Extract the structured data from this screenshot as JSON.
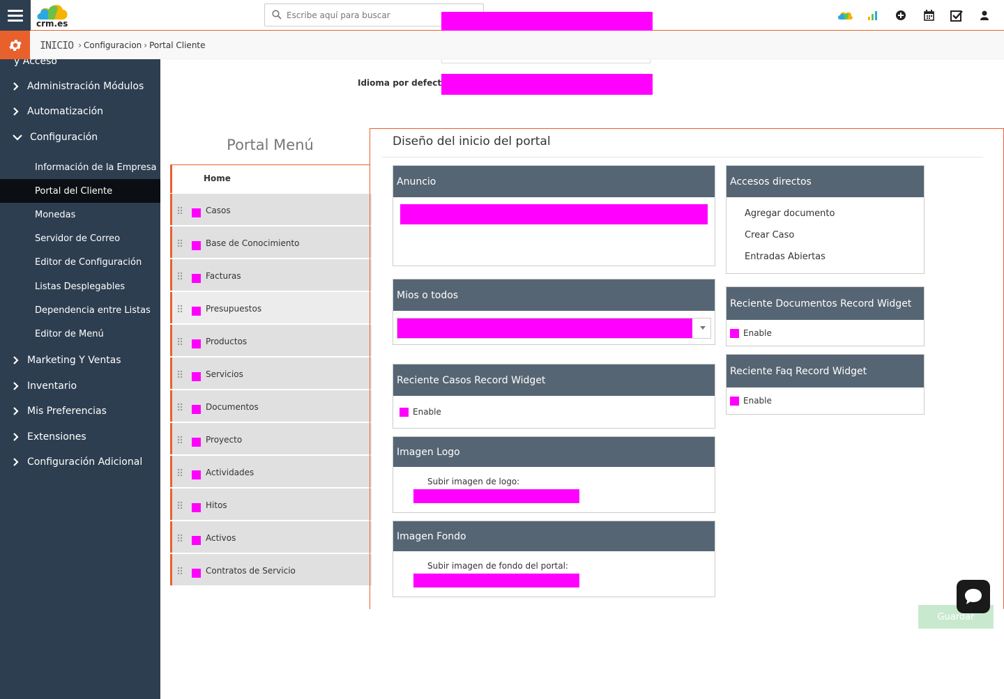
{
  "header": {
    "logo_text": "crm.es",
    "search_placeholder": "Escribe aquí para buscar",
    "icons": [
      "cloud-icon",
      "bar-chart-icon",
      "plus-circle-icon",
      "calendar-icon",
      "checkbox-icon",
      "user-icon"
    ]
  },
  "breadcrumb": {
    "home": "INICIO",
    "level1": "Configuracion",
    "level2": "Portal Cliente"
  },
  "sidebar": {
    "truncated_top": "y Acceso",
    "items": [
      {
        "label": "Administración Módulos",
        "expanded": false
      },
      {
        "label": "Automatización",
        "expanded": false
      },
      {
        "label": "Configuración",
        "expanded": true
      },
      {
        "label": "Marketing Y Ventas",
        "expanded": false
      },
      {
        "label": "Inventario",
        "expanded": false
      },
      {
        "label": "Mis Preferencias",
        "expanded": false
      },
      {
        "label": "Extensiones",
        "expanded": false
      },
      {
        "label": "Configuración Adicional",
        "expanded": false
      }
    ],
    "sub_items": [
      {
        "label": "Información de la Empresa",
        "active": false
      },
      {
        "label": "Portal del Cliente",
        "active": true
      },
      {
        "label": "Monedas",
        "active": false
      },
      {
        "label": "Servidor de Correo",
        "active": false
      },
      {
        "label": "Editor de Configuración",
        "active": false
      },
      {
        "label": "Listas Desplegables",
        "active": false
      },
      {
        "label": "Dependencia entre Listas",
        "active": false
      },
      {
        "label": "Editor de Menú",
        "active": false
      }
    ]
  },
  "form": {
    "default_language_label": "Idioma por defecto"
  },
  "portal_menu": {
    "title": "Portal Menú",
    "home_label": "Home",
    "items": [
      "Casos",
      "Base de Conocimiento",
      "Facturas",
      "Presupuestos",
      "Productos",
      "Servicios",
      "Documentos",
      "Proyecto",
      "Actividades",
      "Hitos",
      "Activos",
      "Contratos de Servicio"
    ]
  },
  "layout": {
    "title": "Diseño del inicio del portal",
    "announcement": {
      "title": "Anuncio"
    },
    "mine_or_all": {
      "title": "Mios o todos"
    },
    "recent_cases": {
      "title": "Reciente Casos Record Widget",
      "enable_label": "Enable"
    },
    "logo_image": {
      "title": "Imagen Logo",
      "upload_label": "Subir imagen de logo:"
    },
    "background_image": {
      "title": "Imagen Fondo",
      "upload_label": "Subir imagen de fondo del portal:"
    },
    "shortcuts": {
      "title": "Accesos directos",
      "links": [
        "Agregar documento",
        "Crear Caso",
        "Entradas Abiertas"
      ]
    },
    "recent_documents": {
      "title": "Reciente Documentos Record Widget",
      "enable_label": "Enable"
    },
    "recent_faq": {
      "title": "Reciente Faq Record Widget",
      "enable_label": "Enable"
    }
  },
  "actions": {
    "save_label": "Guardar"
  },
  "colors": {
    "accent": "#e8612c",
    "sidebar_bg": "#2d3e50",
    "widget_header": "#566573",
    "redacted": "#ff00ff"
  }
}
